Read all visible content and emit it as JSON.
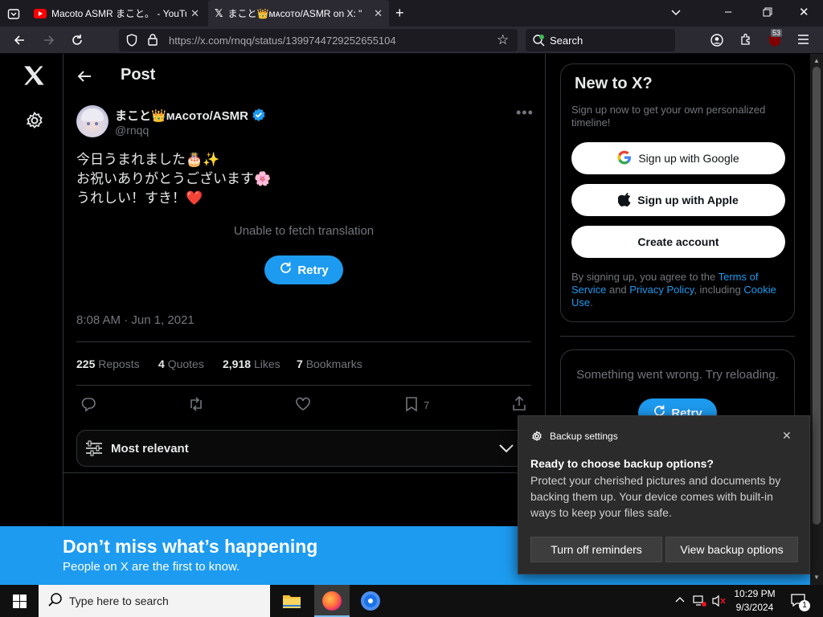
{
  "browser": {
    "tabs": [
      {
        "title": "Macoto ASMR まこと。 - YouTube"
      },
      {
        "title": "まこと👑ᴍᴀᴄᴏᴛᴏ/ASMR on X: \""
      }
    ],
    "url_host": "https://x.com",
    "url_path": "/rnqq/status/1399744729252655104",
    "search_placeholder": "Search",
    "extension_badge": "53"
  },
  "post": {
    "header": "Post",
    "display_name": "まこと👑ᴍᴀᴄᴏᴛᴏ/ASMR",
    "handle": "@rnqq",
    "line1": "今日うまれました🎂✨",
    "line2": "お祝いありがとうございます🌸",
    "line3": "うれしい！すき！❤️",
    "translation_status": "Unable to fetch translation",
    "retry_label": "Retry",
    "timestamp": "8:08 AM · Jun 1, 2021",
    "reposts_count": "225",
    "reposts_label": "Reposts",
    "quotes_count": "4",
    "quotes_label": "Quotes",
    "likes_count": "2,918",
    "likes_label": "Likes",
    "bookmarks_count": "7",
    "bookmarks_label": "Bookmarks",
    "bookmark_action_count": "7",
    "sort_label": "Most relevant"
  },
  "sidebar": {
    "title": "New to X?",
    "subtitle": "Sign up now to get your own personalized timeline!",
    "google_label": "Sign up with Google",
    "apple_label": "Sign up with Apple",
    "create_label": "Create account",
    "legal_1": "By signing up, you agree to the ",
    "legal_terms": "Terms of Service",
    "legal_2": " and ",
    "legal_privacy": "Privacy Policy",
    "legal_3": ", including ",
    "legal_cookie": "Cookie Use",
    "legal_4": ".",
    "error_text": "Something went wrong. Try reloading.",
    "retry_label": "Retry"
  },
  "banner": {
    "title": "Don’t miss what’s happening",
    "subtitle": "People on X are the first to know."
  },
  "notification": {
    "app": "Backup settings",
    "title": "Ready to choose backup options?",
    "body": "Protect your cherished pictures and documents by backing them up. Your device comes with built-in ways to keep your files safe.",
    "btn_off": "Turn off reminders",
    "btn_view": "View backup options"
  },
  "taskbar": {
    "search_placeholder": "Type here to search",
    "time": "10:29 PM",
    "date": "9/3/2024",
    "notif_count": "1"
  },
  "colors": {
    "accent": "#1d9bf0",
    "background": "#000000",
    "browser_chrome": "#2b2a33"
  }
}
